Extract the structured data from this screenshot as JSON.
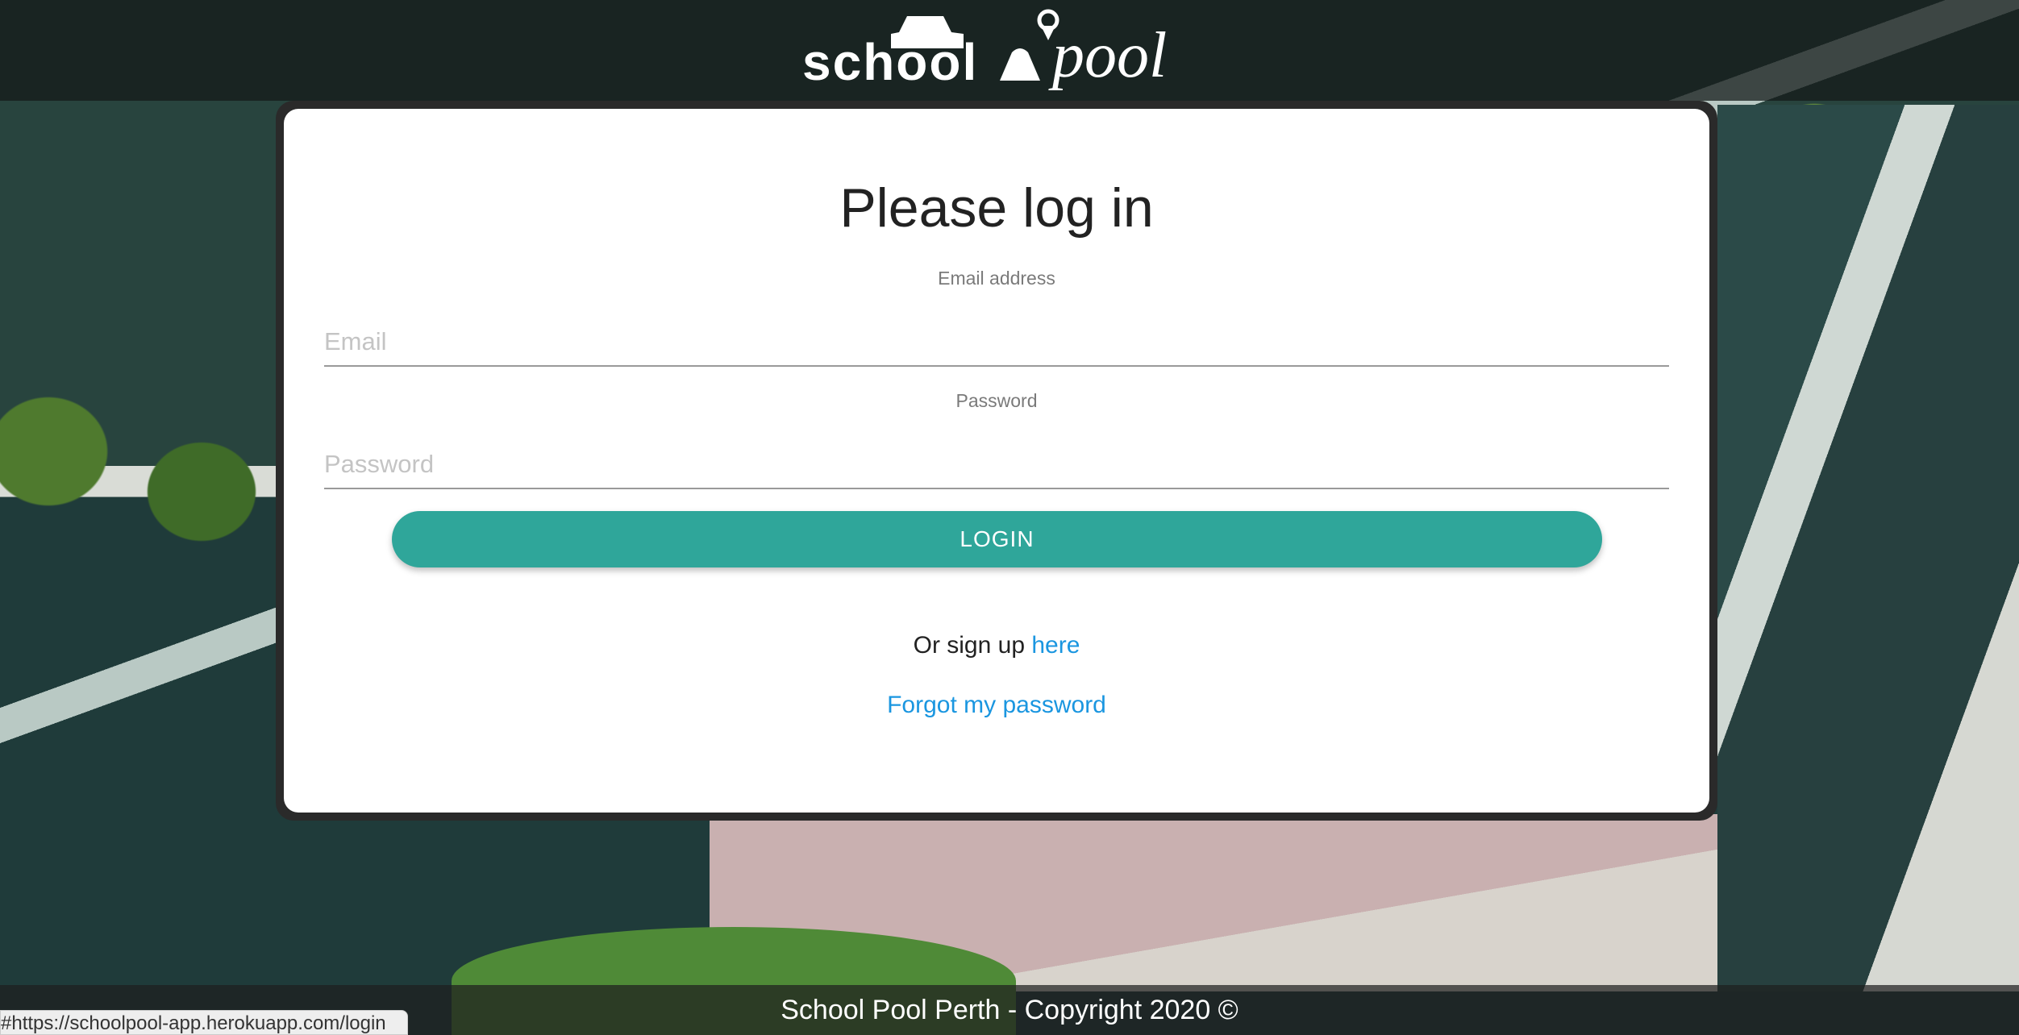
{
  "header": {
    "logo_left": "school",
    "logo_right": "pool"
  },
  "login": {
    "title": "Please log in",
    "email_label": "Email address",
    "email_placeholder": "Email",
    "email_value": "",
    "password_label": "Password",
    "password_placeholder": "Password",
    "password_value": "",
    "login_button": "LOGIN",
    "signup_prefix": "Or sign up ",
    "signup_link": "here",
    "forgot_link": "Forgot my password"
  },
  "footer": {
    "text": "School Pool Perth - Copyright 2020 ©"
  },
  "status_bar": {
    "url": "https://schoolpool-app.herokuapp.com/login#"
  },
  "colors": {
    "accent": "#2fa69a",
    "link": "#1a96e0"
  }
}
